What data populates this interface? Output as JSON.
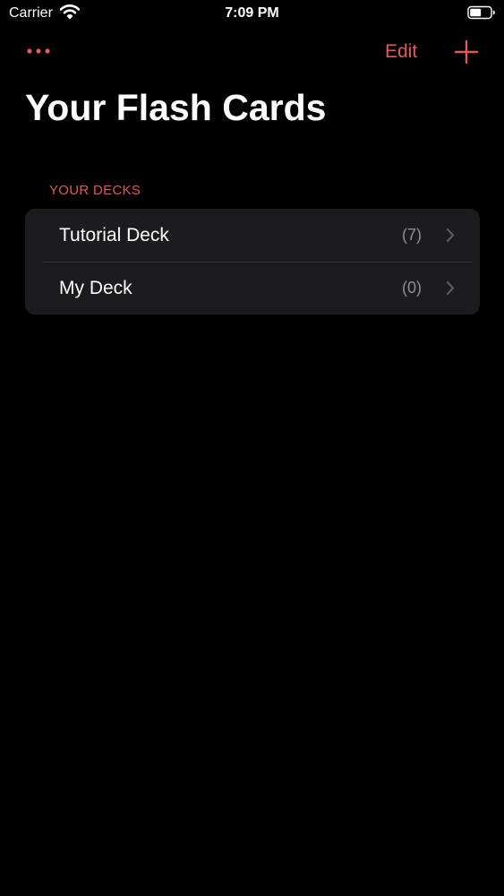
{
  "status_bar": {
    "carrier": "Carrier",
    "time": "7:09 PM"
  },
  "nav": {
    "more_icon": "ellipsis-icon",
    "edit_label": "Edit",
    "add_icon": "plus-icon"
  },
  "title": "Your Flash Cards",
  "section": {
    "header": "YOUR DECKS"
  },
  "decks": [
    {
      "name": "Tutorial Deck",
      "count": "(7)"
    },
    {
      "name": "My Deck",
      "count": "(0)"
    }
  ],
  "colors": {
    "accent": "#e05a57",
    "background": "#000000",
    "list_background": "#1c1c1e",
    "secondary_text": "#8e8e93"
  }
}
